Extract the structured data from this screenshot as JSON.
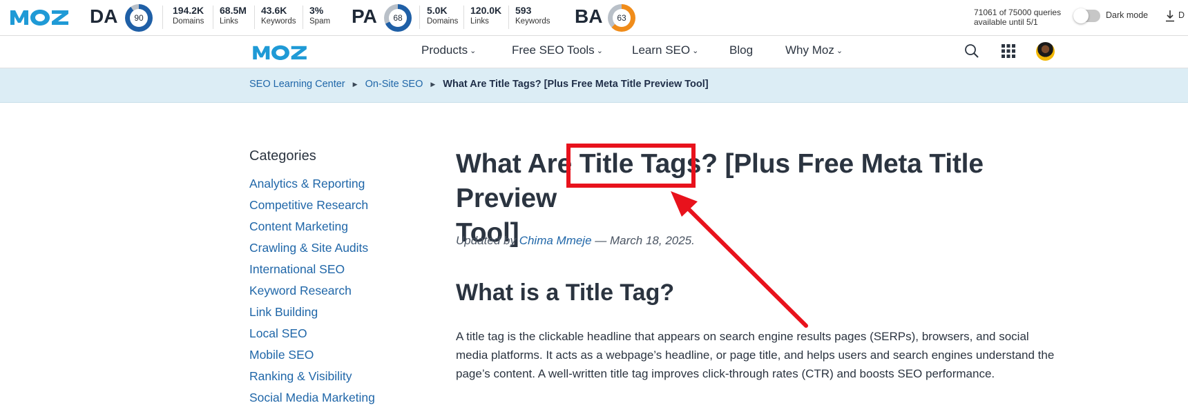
{
  "mozbar": {
    "logo": "MOZ",
    "da": {
      "label": "DA",
      "score": "90",
      "color": "#1f5fa6",
      "percent": 90
    },
    "da_metrics": [
      {
        "value": "194.2K",
        "label": "Domains"
      },
      {
        "value": "68.5M",
        "label": "Links"
      },
      {
        "value": "43.6K",
        "label": "Keywords"
      },
      {
        "value": "3%",
        "label": "Spam"
      }
    ],
    "pa": {
      "label": "PA",
      "score": "68",
      "color": "#1f5fa6",
      "percent": 68
    },
    "pa_metrics": [
      {
        "value": "5.0K",
        "label": "Domains"
      },
      {
        "value": "120.0K",
        "label": "Links"
      },
      {
        "value": "593",
        "label": "Keywords"
      }
    ],
    "ba": {
      "label": "BA",
      "score": "63",
      "color": "#f08c1a",
      "percent": 63
    },
    "quota_line1": "71061 of 75000 queries",
    "quota_line2": "available until 5/1",
    "dark_mode_label": "Dark mode",
    "dark_mode_on": false,
    "download_label": "D"
  },
  "nav": {
    "logo": "MOZ",
    "items": [
      {
        "label": "Products",
        "dropdown": true
      },
      {
        "label": "Free SEO Tools",
        "dropdown": true
      },
      {
        "label": "Learn SEO",
        "dropdown": true
      },
      {
        "label": "Blog",
        "dropdown": false
      },
      {
        "label": "Why Moz",
        "dropdown": true
      }
    ]
  },
  "breadcrumb": {
    "items": [
      "SEO Learning Center",
      "On-Site SEO"
    ],
    "current": "What Are Title Tags? [Plus Free Meta Title Preview Tool]"
  },
  "sidebar": {
    "heading": "Categories",
    "items": [
      "Analytics & Reporting",
      "Competitive Research",
      "Content Marketing",
      "Crawling & Site Audits",
      "International SEO",
      "Keyword Research",
      "Link Building",
      "Local SEO",
      "Mobile SEO",
      "Ranking & Visibility",
      "Social Media Marketing"
    ]
  },
  "article": {
    "title_line1": "What Are Title Tags? [Plus Free Meta Title Preview",
    "title_line2": "Tool]",
    "byline_prefix": "Updated by",
    "author": "Chima Mmeje",
    "byline_suffix": "— March 18, 2025.",
    "h2": "What is a Title Tag?",
    "paragraph": "A title tag is the clickable headline that appears on search engine results pages (SERPs), browsers, and social media platforms. It acts as a webpage’s headline, or page title, and helps users and search engines understand the page’s content. A well-written title tag improves click-through rates (CTR) and boosts SEO performance."
  },
  "annotation": {
    "color": "#e8121c"
  }
}
